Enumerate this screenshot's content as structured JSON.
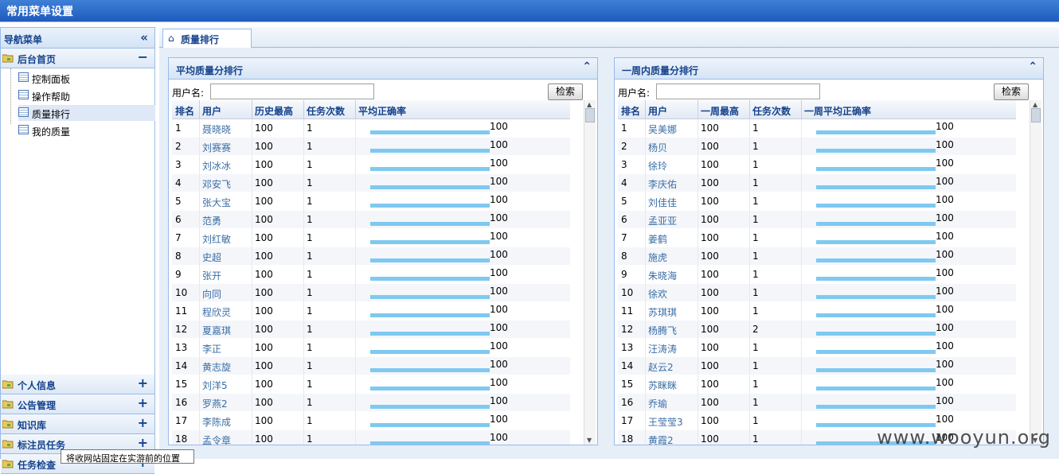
{
  "app": {
    "title": "常用菜单设置"
  },
  "nav": {
    "header": "导航菜单",
    "collapse_symbol": "«",
    "sections": [
      {
        "label": "后台首页",
        "toggle": "−"
      },
      {
        "label": "个人信息",
        "toggle": "+"
      },
      {
        "label": "公告管理",
        "toggle": "+"
      },
      {
        "label": "知识库",
        "toggle": "+"
      },
      {
        "label": "标注员任务",
        "toggle": "+"
      },
      {
        "label": "任务检查",
        "toggle": "+"
      }
    ],
    "items": [
      {
        "label": "控制面板"
      },
      {
        "label": "操作帮助"
      },
      {
        "label": "质量排行",
        "selected": true
      },
      {
        "label": "我的质量"
      }
    ]
  },
  "tab": {
    "label": "质量排行"
  },
  "tooltip": "将收网站固定在实游前的位置",
  "watermark": "www.wooyun.org",
  "panels": [
    {
      "title": "平均质量分排行",
      "search_label": "用户名:",
      "search_value": "",
      "search_button": "检索",
      "columns": [
        "排名",
        "用户",
        "历史最高",
        "任务次数",
        "平均正确率"
      ],
      "rows": [
        [
          "1",
          "聂晓晓",
          "100",
          "1",
          "100"
        ],
        [
          "2",
          "刘赛赛",
          "100",
          "1",
          "100"
        ],
        [
          "3",
          "刘冰冰",
          "100",
          "1",
          "100"
        ],
        [
          "4",
          "邓安飞",
          "100",
          "1",
          "100"
        ],
        [
          "5",
          "张大宝",
          "100",
          "1",
          "100"
        ],
        [
          "6",
          "范勇",
          "100",
          "1",
          "100"
        ],
        [
          "7",
          "刘红敏",
          "100",
          "1",
          "100"
        ],
        [
          "8",
          "史超",
          "100",
          "1",
          "100"
        ],
        [
          "9",
          "张开",
          "100",
          "1",
          "100"
        ],
        [
          "10",
          "向同",
          "100",
          "1",
          "100"
        ],
        [
          "11",
          "程欣灵",
          "100",
          "1",
          "100"
        ],
        [
          "12",
          "夏嘉琪",
          "100",
          "1",
          "100"
        ],
        [
          "13",
          "李正",
          "100",
          "1",
          "100"
        ],
        [
          "14",
          "黄志旋",
          "100",
          "1",
          "100"
        ],
        [
          "15",
          "刘洋5",
          "100",
          "1",
          "100"
        ],
        [
          "16",
          "罗燕2",
          "100",
          "1",
          "100"
        ],
        [
          "17",
          "李陈成",
          "100",
          "1",
          "100"
        ],
        [
          "18",
          "孟令章",
          "100",
          "1",
          "100"
        ]
      ]
    },
    {
      "title": "一周内质量分排行",
      "search_label": "用户名:",
      "search_value": "",
      "search_button": "检索",
      "columns": [
        "排名",
        "用户",
        "一周最高",
        "任务次数",
        "一周平均正确率"
      ],
      "rows": [
        [
          "1",
          "吴美娜",
          "100",
          "1",
          "100"
        ],
        [
          "2",
          "杨贝",
          "100",
          "1",
          "100"
        ],
        [
          "3",
          "徐玲",
          "100",
          "1",
          "100"
        ],
        [
          "4",
          "李庆佑",
          "100",
          "1",
          "100"
        ],
        [
          "5",
          "刘佳佳",
          "100",
          "1",
          "100"
        ],
        [
          "6",
          "孟亚亚",
          "100",
          "1",
          "100"
        ],
        [
          "7",
          "姜鹤",
          "100",
          "1",
          "100"
        ],
        [
          "8",
          "施虎",
          "100",
          "1",
          "100"
        ],
        [
          "9",
          "朱晓海",
          "100",
          "1",
          "100"
        ],
        [
          "10",
          "徐欢",
          "100",
          "1",
          "100"
        ],
        [
          "11",
          "苏琪琪",
          "100",
          "1",
          "100"
        ],
        [
          "12",
          "杨腾飞",
          "100",
          "2",
          "100"
        ],
        [
          "13",
          "汪涛涛",
          "100",
          "1",
          "100"
        ],
        [
          "14",
          "赵云2",
          "100",
          "1",
          "100"
        ],
        [
          "15",
          "苏眯眯",
          "100",
          "1",
          "100"
        ],
        [
          "16",
          "乔瑜",
          "100",
          "1",
          "100"
        ],
        [
          "17",
          "王莹莹3",
          "100",
          "1",
          "100"
        ],
        [
          "18",
          "黄霞2",
          "100",
          "1",
          "100"
        ]
      ]
    }
  ]
}
